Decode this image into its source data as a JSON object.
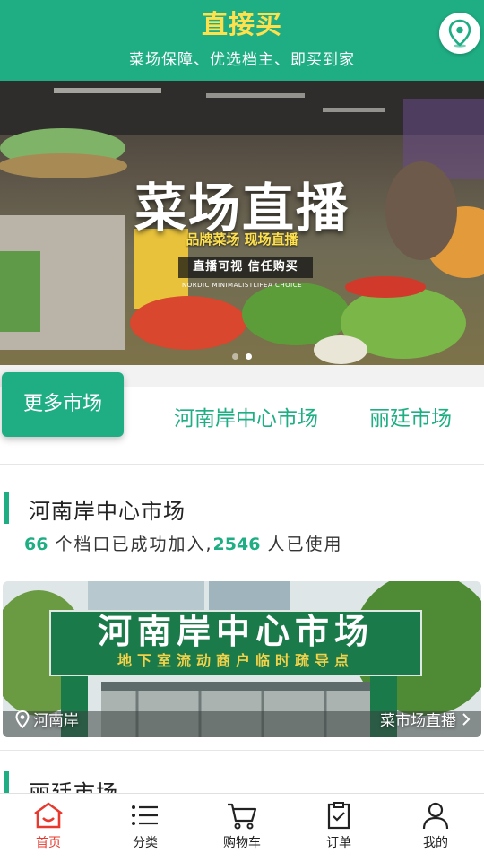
{
  "header": {
    "title": "直接买",
    "subtitle": "菜场保障、优选档主、即买到家",
    "location_icon": "map-pin-icon"
  },
  "banner": {
    "title": "菜场直播",
    "tagline": "品牌菜场 现场直播",
    "pill_text": "直播可视 信任购买",
    "small_text": "NORDIC MINIMALISTLIFEA CHOICE",
    "slides": 2,
    "active_slide": 2
  },
  "market_tabs": {
    "more_label": "更多市场",
    "tabs": [
      "河南岸中心市场",
      "丽廷市场"
    ]
  },
  "market_card": {
    "name": "河南岸中心市场",
    "stalls_count": "66",
    "stalls_text": " 个档口已成功加入,",
    "users_count": "2546",
    "users_text": " 人已使用",
    "photo": {
      "sign_main": "河南岸中心市场",
      "sign_sub": "地下室流动商户临时疏导点",
      "location": "河南岸",
      "link_label": "菜市场直播"
    }
  },
  "next_market": {
    "name": "丽廷市场"
  },
  "bottom_nav": {
    "items": [
      {
        "label": "首页",
        "icon": "home-icon",
        "active": true
      },
      {
        "label": "分类",
        "icon": "list-icon",
        "active": false
      },
      {
        "label": "购物车",
        "icon": "cart-icon",
        "active": false
      },
      {
        "label": "订单",
        "icon": "order-icon",
        "active": false
      },
      {
        "label": "我的",
        "icon": "user-icon",
        "active": false
      }
    ]
  },
  "colors": {
    "brand": "#1fae84",
    "title_yellow": "#ffe14d",
    "active_nav": "#e8392e"
  }
}
